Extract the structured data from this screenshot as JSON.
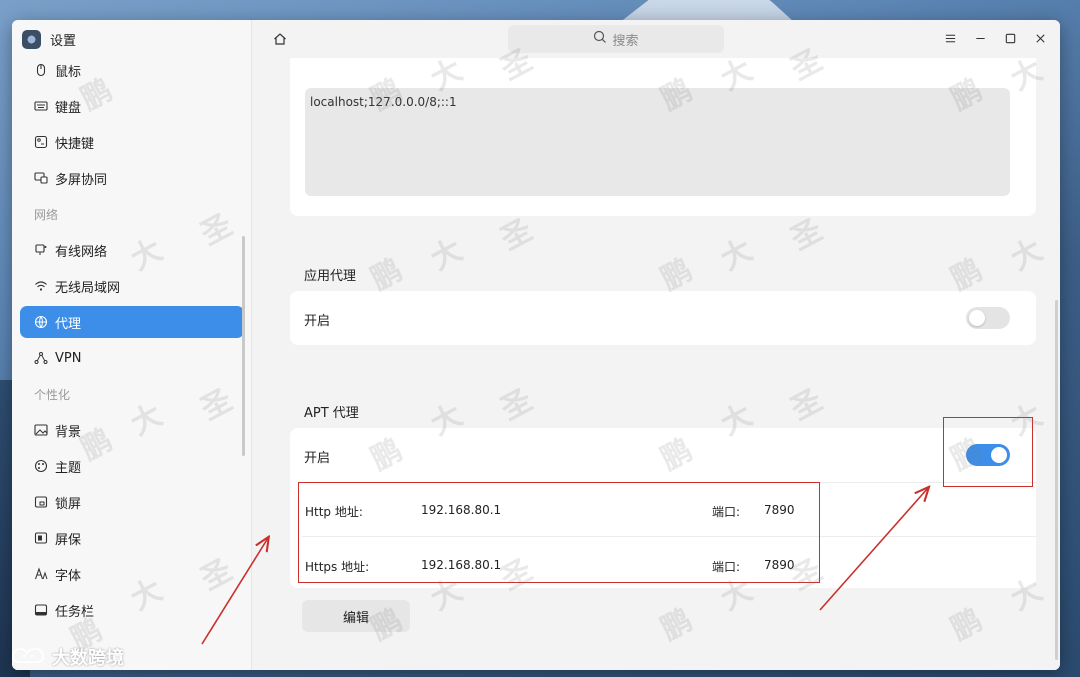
{
  "app": {
    "title": "设置",
    "search_placeholder": "搜索"
  },
  "sidebar": {
    "items_top": [
      {
        "label": "鼠标",
        "icon": "mouse-icon"
      },
      {
        "label": "键盘",
        "icon": "keyboard-icon"
      },
      {
        "label": "快捷键",
        "icon": "shortcut-icon"
      },
      {
        "label": "多屏协同",
        "icon": "multiscreen-icon"
      }
    ],
    "section_network": "网络",
    "items_network": [
      {
        "label": "有线网络",
        "icon": "wired-network-icon"
      },
      {
        "label": "无线局域网",
        "icon": "wifi-icon"
      },
      {
        "label": "代理",
        "icon": "proxy-icon",
        "active": true
      },
      {
        "label": "VPN",
        "icon": "vpn-icon"
      }
    ],
    "section_personal": "个性化",
    "items_personal": [
      {
        "label": "背景",
        "icon": "background-icon"
      },
      {
        "label": "主题",
        "icon": "theme-icon"
      },
      {
        "label": "锁屏",
        "icon": "lockscreen-icon"
      },
      {
        "label": "屏保",
        "icon": "screensaver-icon"
      },
      {
        "label": "字体",
        "icon": "font-icon"
      },
      {
        "label": "任务栏",
        "icon": "taskbar-icon"
      }
    ]
  },
  "main": {
    "ignore_hosts_value": "localhost;127.0.0.0/8;::1",
    "app_proxy": {
      "title": "应用代理",
      "toggle_label": "开启",
      "enabled": false
    },
    "apt_proxy": {
      "title": "APT 代理",
      "toggle_label": "开启",
      "enabled": true,
      "http_label": "Http 地址:",
      "http_address": "192.168.80.1",
      "https_label": "Https 地址:",
      "https_address": "192.168.80.1",
      "port_label": "端口:",
      "http_port": "7890",
      "https_port": "7890"
    },
    "edit_button": "编辑"
  },
  "watermark": {
    "chars": [
      "大",
      "圣",
      "鹏"
    ],
    "bottom_text": "大数跨境"
  },
  "colors": {
    "accent": "#3d8ee9",
    "annotation": "#c9302c"
  }
}
